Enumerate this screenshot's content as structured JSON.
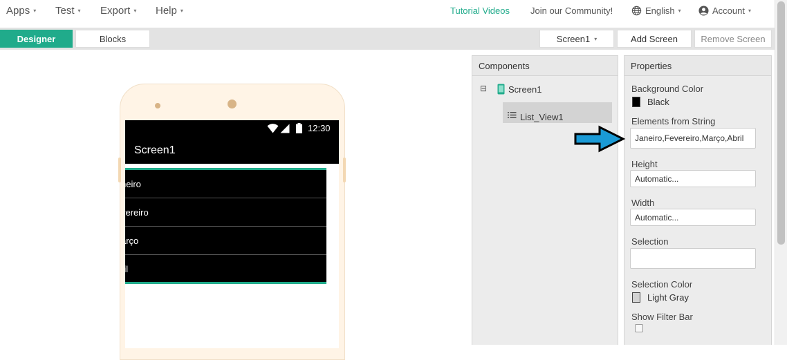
{
  "menu": {
    "apps": "Apps",
    "test": "Test",
    "export": "Export",
    "help": "Help",
    "caret": "▾"
  },
  "topright": {
    "tutorial": "Tutorial Videos",
    "community": "Join our Community!",
    "language": "English",
    "account": "Account"
  },
  "toolbar": {
    "designer": "Designer",
    "blocks": "Blocks",
    "screen_select": "Screen1",
    "add_screen": "Add Screen",
    "remove_screen": "Remove Screen"
  },
  "phone": {
    "time": "12:30",
    "title": "Screen1",
    "list_items": [
      "neiro",
      "vereiro",
      "arço",
      "ril"
    ]
  },
  "components": {
    "header": "Components",
    "collapse": "⊟",
    "screen": "Screen1",
    "listview": "List_View1"
  },
  "properties": {
    "header": "Properties",
    "bg_color_label": "Background Color",
    "bg_color_value": "Black",
    "elements_label": "Elements from String",
    "elements_value": "Janeiro,Fevereiro,Março,Abril",
    "height_label": "Height",
    "height_value": "Automatic...",
    "width_label": "Width",
    "width_value": "Automatic...",
    "selection_label": "Selection",
    "selection_value": "",
    "selection_color_label": "Selection Color",
    "selection_color_value": "Light Gray",
    "filter_bar_label": "Show Filter Bar"
  },
  "colors": {
    "accent": "#20ab8b",
    "arrow": "#1a9ad6",
    "background_color_swatch": "#000000",
    "selection_color_swatch": "#d3d3d3"
  }
}
